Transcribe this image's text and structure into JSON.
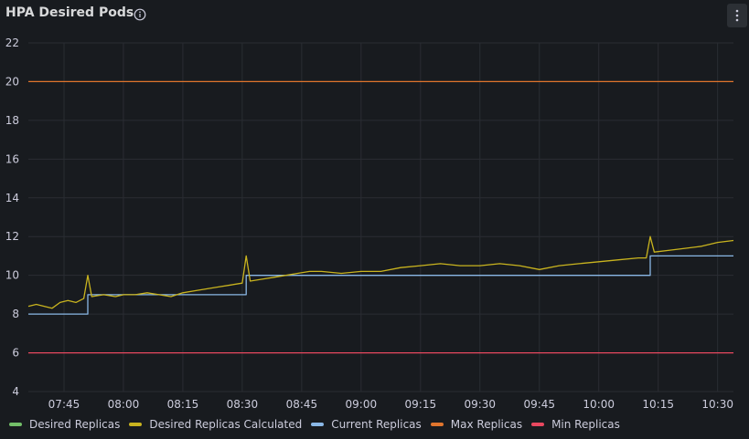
{
  "panel": {
    "title": "HPA Desired Pods",
    "info_icon": "info-circle-icon",
    "menu_icon": "kebab-menu-icon"
  },
  "colors": {
    "background": "#181b1f",
    "grid": "#2a2d33",
    "desired": "#73bf69",
    "calculated": "#c9b41f",
    "current": "#8ab8e6",
    "max": "#e0752d",
    "min": "#e8485f"
  },
  "chart_data": {
    "type": "line",
    "title": "HPA Desired Pods",
    "x_ticks": [
      "07:45",
      "08:00",
      "08:15",
      "08:30",
      "08:45",
      "09:00",
      "09:15",
      "09:30",
      "09:45",
      "10:00",
      "10:15",
      "10:30"
    ],
    "x_range": [
      "07:36",
      "10:34"
    ],
    "y_ticks": [
      4,
      6,
      8,
      10,
      12,
      14,
      16,
      18,
      20,
      22
    ],
    "ylim": [
      4,
      22
    ],
    "grid": true,
    "legend_position": "bottom",
    "series": [
      {
        "name": "Desired Replicas",
        "color": "#73bf69",
        "points": []
      },
      {
        "name": "Desired Replicas Calculated",
        "color": "#c9b41f",
        "points": [
          [
            "07:36",
            8.4
          ],
          [
            "07:38",
            8.5
          ],
          [
            "07:40",
            8.4
          ],
          [
            "07:42",
            8.3
          ],
          [
            "07:44",
            8.6
          ],
          [
            "07:46",
            8.7
          ],
          [
            "07:48",
            8.6
          ],
          [
            "07:50",
            8.8
          ],
          [
            "07:51",
            10.0
          ],
          [
            "07:52",
            8.9
          ],
          [
            "07:55",
            9.0
          ],
          [
            "07:58",
            8.9
          ],
          [
            "08:00",
            9.0
          ],
          [
            "08:03",
            9.0
          ],
          [
            "08:06",
            9.1
          ],
          [
            "08:09",
            9.0
          ],
          [
            "08:12",
            8.9
          ],
          [
            "08:15",
            9.1
          ],
          [
            "08:18",
            9.2
          ],
          [
            "08:21",
            9.3
          ],
          [
            "08:24",
            9.4
          ],
          [
            "08:27",
            9.5
          ],
          [
            "08:30",
            9.6
          ],
          [
            "08:31",
            11.0
          ],
          [
            "08:32",
            9.7
          ],
          [
            "08:35",
            9.8
          ],
          [
            "08:38",
            9.9
          ],
          [
            "08:41",
            10.0
          ],
          [
            "08:44",
            10.1
          ],
          [
            "08:47",
            10.2
          ],
          [
            "08:50",
            10.2
          ],
          [
            "08:55",
            10.1
          ],
          [
            "09:00",
            10.2
          ],
          [
            "09:05",
            10.2
          ],
          [
            "09:10",
            10.4
          ],
          [
            "09:15",
            10.5
          ],
          [
            "09:20",
            10.6
          ],
          [
            "09:25",
            10.5
          ],
          [
            "09:30",
            10.5
          ],
          [
            "09:35",
            10.6
          ],
          [
            "09:40",
            10.5
          ],
          [
            "09:45",
            10.3
          ],
          [
            "09:50",
            10.5
          ],
          [
            "09:55",
            10.6
          ],
          [
            "10:00",
            10.7
          ],
          [
            "10:05",
            10.8
          ],
          [
            "10:10",
            10.9
          ],
          [
            "10:12",
            10.9
          ],
          [
            "10:13",
            12.0
          ],
          [
            "10:14",
            11.2
          ],
          [
            "10:18",
            11.3
          ],
          [
            "10:22",
            11.4
          ],
          [
            "10:26",
            11.5
          ],
          [
            "10:30",
            11.7
          ],
          [
            "10:34",
            11.8
          ]
        ]
      },
      {
        "name": "Current Replicas",
        "color": "#8ab8e6",
        "points": [
          [
            "07:36",
            8
          ],
          [
            "07:51",
            8
          ],
          [
            "07:51",
            9
          ],
          [
            "08:31",
            9
          ],
          [
            "08:31",
            10
          ],
          [
            "10:13",
            10
          ],
          [
            "10:13",
            11
          ],
          [
            "10:34",
            11
          ]
        ]
      },
      {
        "name": "Max Replicas",
        "color": "#e0752d",
        "points": [
          [
            "07:36",
            20
          ],
          [
            "10:34",
            20
          ]
        ]
      },
      {
        "name": "Min Replicas",
        "color": "#e8485f",
        "points": [
          [
            "07:36",
            6
          ],
          [
            "10:34",
            6
          ]
        ]
      }
    ]
  },
  "legend": [
    {
      "label": "Desired Replicas",
      "color": "#73bf69"
    },
    {
      "label": "Desired Replicas Calculated",
      "color": "#c9b41f"
    },
    {
      "label": "Current Replicas",
      "color": "#8ab8e6"
    },
    {
      "label": "Max Replicas",
      "color": "#e0752d"
    },
    {
      "label": "Min Replicas",
      "color": "#e8485f"
    }
  ]
}
